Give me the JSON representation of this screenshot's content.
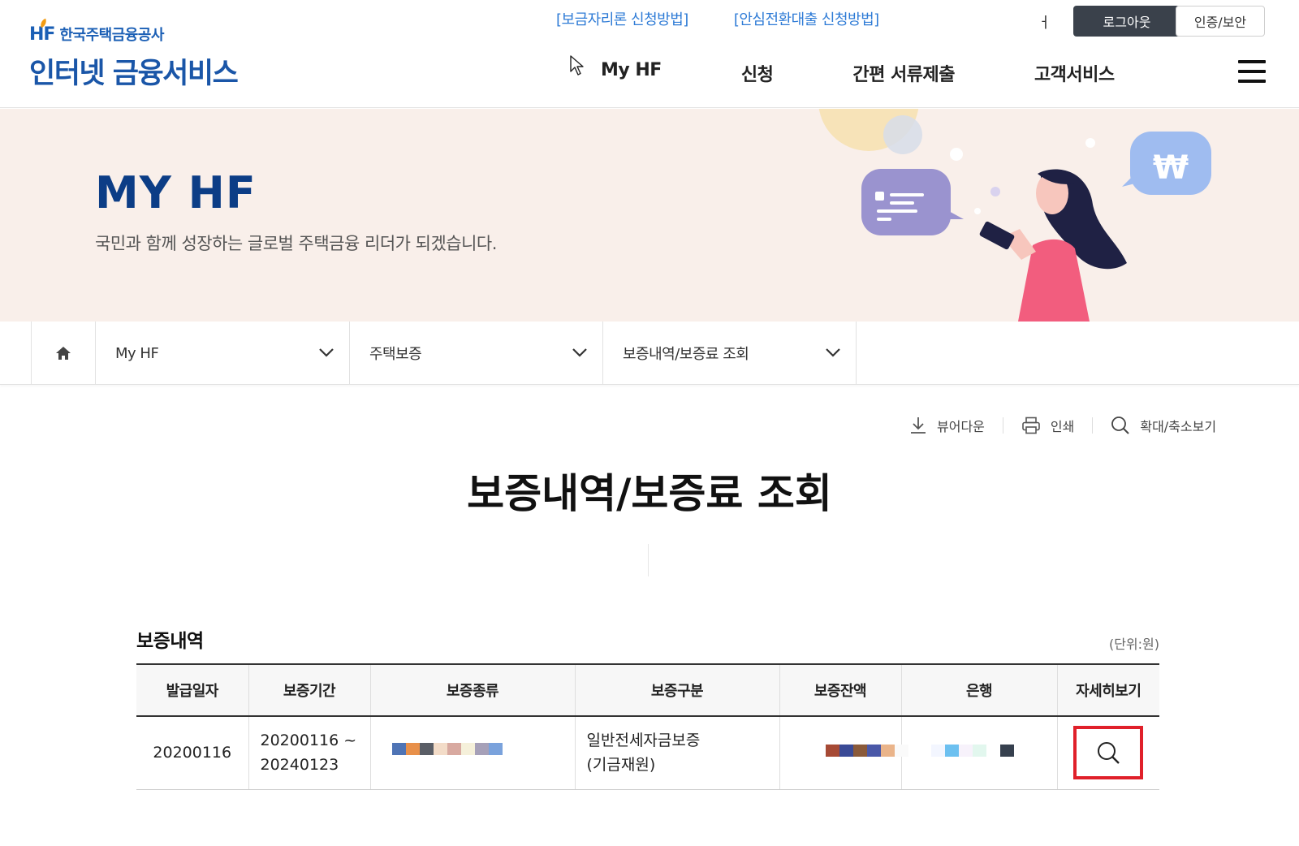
{
  "header": {
    "org_name": "한국주택금융공사",
    "hf_mark": "HF",
    "service_name": "인터넷 금융서비스",
    "top_links": [
      "[보금자리론 신청방법]",
      "[안심전환대출 신청방법]"
    ],
    "stray_glyph": "ㅓ",
    "logout_label": "로그아웃",
    "cert_label": "인증/보안",
    "nav": [
      "My HF",
      "신청",
      "간편 서류제출",
      "고객서비스"
    ]
  },
  "banner": {
    "title": "MY HF",
    "subtitle": "국민과 함께 성장하는 글로벌 주택금융 리더가 되겠습니다.",
    "won_symbol": "₩"
  },
  "breadcrumb": {
    "items": [
      "My HF",
      "주택보증",
      "보증내역/보증료 조회"
    ]
  },
  "tools": {
    "viewer_download": "뷰어다운",
    "print": "인쇄",
    "zoom": "확대/축소보기"
  },
  "page": {
    "title": "보증내역/보증료 조회"
  },
  "section": {
    "title": "보증내역",
    "unit": "(단위:원)"
  },
  "table": {
    "headers": [
      "발급일자",
      "보증기간",
      "보증종류",
      "보증구분",
      "보증잔액",
      "은행",
      "자세히보기"
    ],
    "rows": [
      {
        "issue_date": "20200116",
        "period_start": "20200116 ~",
        "period_end": "20240123",
        "category_line1": "일반전세자금보증",
        "category_line2": "(기금재원)"
      }
    ]
  },
  "colors": {
    "brand_blue": "#1a56a8",
    "link_blue": "#2e7bd6",
    "banner_bg": "#f9efea",
    "banner_title": "#0c3d86",
    "highlight_red": "#e0202a",
    "logout_bg": "#3a414b"
  },
  "icons": {
    "home": "home-icon",
    "chevron": "chevron-down-icon",
    "download": "download-icon",
    "print": "printer-icon",
    "zoom": "search-icon",
    "menu": "hamburger-menu-icon",
    "detail": "search-icon"
  }
}
